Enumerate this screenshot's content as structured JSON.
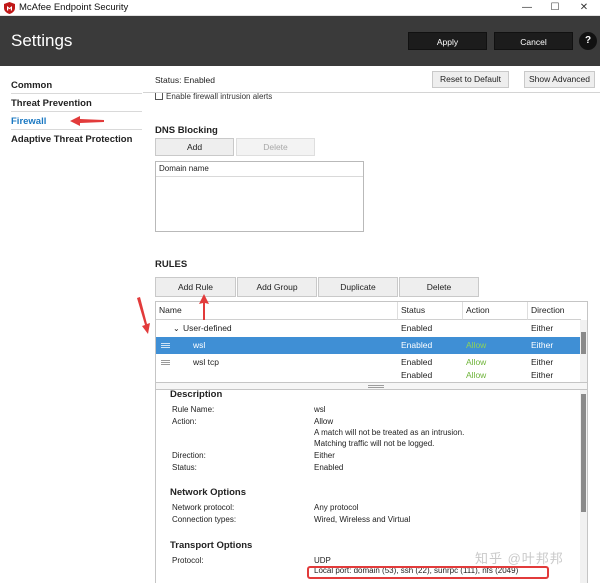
{
  "window": {
    "title": "McAfee Endpoint Security",
    "minimize": "—",
    "maximize": "☐",
    "close": "✕"
  },
  "header": {
    "title": "Settings",
    "apply_label": "Apply",
    "cancel_label": "Cancel",
    "help_label": "?"
  },
  "nav": {
    "items": [
      {
        "label": "Common"
      },
      {
        "label": "Threat Prevention"
      },
      {
        "label": "Firewall"
      },
      {
        "label": "Adaptive Threat Protection"
      }
    ],
    "active": "Firewall"
  },
  "toolbar": {
    "status": "Status: Enabled",
    "reset_label": "Reset to Default",
    "advanced_label": "Show Advanced"
  },
  "alert_text": "Enable firewall intrusion alerts",
  "dns": {
    "title": "DNS Blocking",
    "add_label": "Add",
    "delete_label": "Delete",
    "column": "Domain name"
  },
  "rules": {
    "title": "RULES",
    "add_rule_label": "Add Rule",
    "add_group_label": "Add Group",
    "duplicate_label": "Duplicate",
    "delete_label": "Delete",
    "columns": [
      "Name",
      "Status",
      "Action",
      "Direction"
    ],
    "rows": [
      {
        "name": "User-defined",
        "status": "Enabled",
        "action": "",
        "direction": "Either"
      },
      {
        "name": "wsl",
        "status": "Enabled",
        "action": "Allow",
        "direction": "Either"
      },
      {
        "name": "wsl tcp",
        "status": "Enabled",
        "action": "Allow",
        "direction": "Either"
      },
      {
        "name": "",
        "status": "Enabled",
        "action": "Allow",
        "direction": "Either"
      }
    ]
  },
  "description": {
    "title": "Description",
    "rule_name_label": "Rule Name:",
    "rule_name": "wsl",
    "action_label": "Action:",
    "action_lines": [
      "Allow",
      "A match will not be treated as an intrusion.",
      "Matching traffic will not be logged."
    ],
    "direction_label": "Direction:",
    "direction": "Either",
    "status_label": "Status:",
    "status": "Enabled",
    "network_title": "Network Options",
    "network_protocol_label": "Network protocol:",
    "network_protocol": "Any protocol",
    "connection_types_label": "Connection types:",
    "connection_types": "Wired, Wireless and Virtual",
    "transport_title": "Transport Options",
    "protocol_label": "Protocol:",
    "protocol": "UDP",
    "local_port": "Local port: domain (53), ssh (22), sunrpc (111), nfs (2049)"
  },
  "watermark": "知乎 @叶邦邦",
  "colors": {
    "header_bg": "#3a3a3a",
    "selected_row": "#3f8fd5",
    "active_nav": "#1a78c2",
    "allow_green": "#6fb43a",
    "annotation_red": "#e23b3b"
  }
}
